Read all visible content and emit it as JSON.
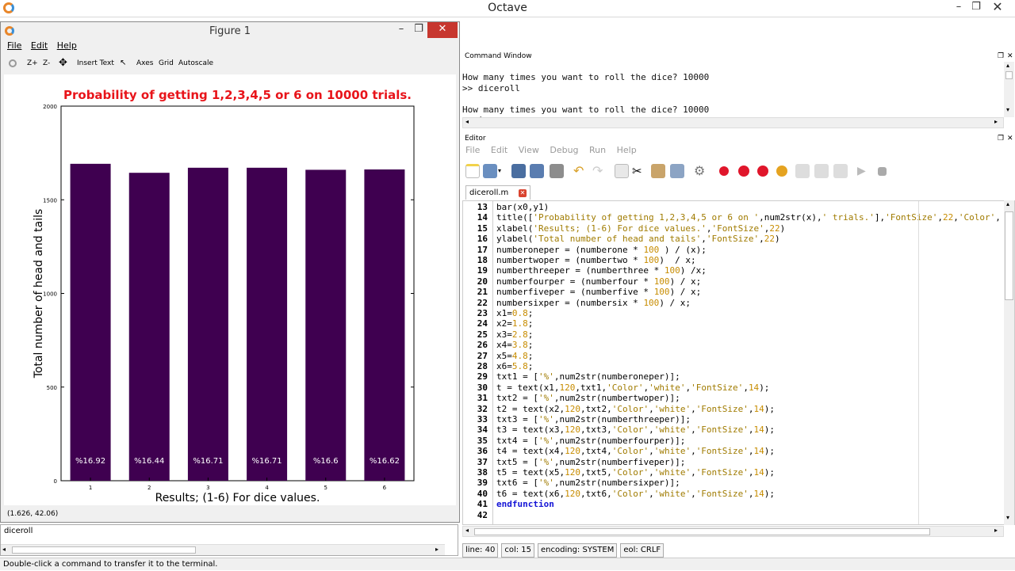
{
  "app": {
    "title": "Octave"
  },
  "figure": {
    "title": "Figure 1",
    "menu": [
      "File",
      "Edit",
      "Help"
    ],
    "toolbar": {
      "zoom_in": "Z+",
      "zoom_out": "Z-",
      "insert_text": "Insert Text",
      "axes": "Axes",
      "grid": "Grid",
      "autoscale": "Autoscale"
    },
    "status": "(1.626, 42.06)"
  },
  "chart_data": {
    "type": "bar",
    "title": "Probability of getting 1,2,3,4,5 or 6 on 10000 trials.",
    "xlabel": "Results; (1-6) For dice values.",
    "ylabel": "Total number of head and tails",
    "categories": [
      "1",
      "2",
      "3",
      "4",
      "5",
      "6"
    ],
    "values": [
      1692,
      1644,
      1671,
      1671,
      1660,
      1662
    ],
    "data_labels": [
      "%16.92",
      "%16.44",
      "%16.71",
      "%16.71",
      "%16.6",
      "%16.62"
    ],
    "ylim": [
      0,
      2000
    ],
    "yticks": [
      "0",
      "500",
      "1000",
      "1500",
      "2000"
    ],
    "bar_color": "#3f0050",
    "title_color": "#e8141a"
  },
  "history": {
    "item": "diceroll"
  },
  "statusbar": "Double-click a command to transfer it to the terminal.",
  "command_window": {
    "header": "Command Window",
    "lines": [
      "How many times you want to roll the dice? 10000",
      ">> diceroll",
      "",
      "How many times you want to roll the dice? 10000",
      ">> |"
    ]
  },
  "editor": {
    "header": "Editor",
    "menu": [
      "File",
      "Edit",
      "View",
      "Debug",
      "Run",
      "Help"
    ],
    "tab": "diceroll.m",
    "line_numbers": [
      "13",
      "14",
      "15",
      "16",
      "17",
      "18",
      "19",
      "20",
      "21",
      "22",
      "23",
      "24",
      "25",
      "26",
      "27",
      "28",
      "29",
      "30",
      "31",
      "32",
      "33",
      "34",
      "35",
      "36",
      "37",
      "38",
      "39",
      "40",
      "41",
      "42"
    ],
    "status": {
      "line": "line: 40",
      "col": "col: 15",
      "encoding": "encoding: SYSTEM",
      "eol": "eol: CRLF"
    }
  }
}
